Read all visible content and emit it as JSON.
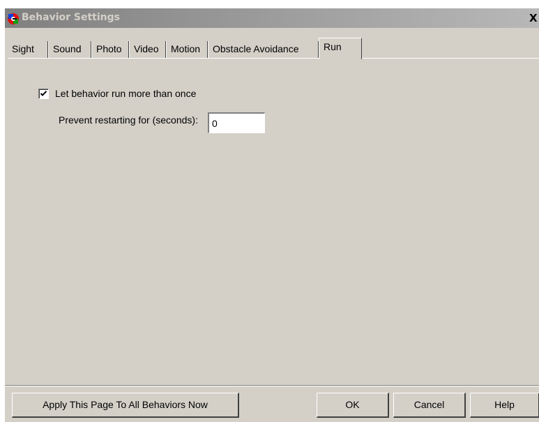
{
  "window": {
    "title": "Behavior Settings",
    "close_glyph": "X"
  },
  "tabs": [
    {
      "label": "Sight",
      "active": false
    },
    {
      "label": "Sound",
      "active": false
    },
    {
      "label": "Photo",
      "active": false
    },
    {
      "label": "Video",
      "active": false
    },
    {
      "label": "Motion",
      "active": false
    },
    {
      "label": "Obstacle Avoidance",
      "active": false
    },
    {
      "label": "Run",
      "active": true
    }
  ],
  "run_page": {
    "run_more_than_once": {
      "label": "Let behavior run more than once",
      "checked": true
    },
    "prevent_restart": {
      "label": "Prevent restarting for (seconds):",
      "value": "0"
    }
  },
  "buttons": {
    "apply_all": "Apply This Page To All Behaviors Now",
    "ok": "OK",
    "cancel": "Cancel",
    "help": "Help"
  },
  "icons": {
    "app": "app-logo-icon",
    "close": "close-icon",
    "check": "checkmark-icon"
  },
  "colors": {
    "dialog_face": "#d4d0c8",
    "titlebar_inactive_start": "#808080",
    "titlebar_inactive_end": "#b8b8b8"
  }
}
